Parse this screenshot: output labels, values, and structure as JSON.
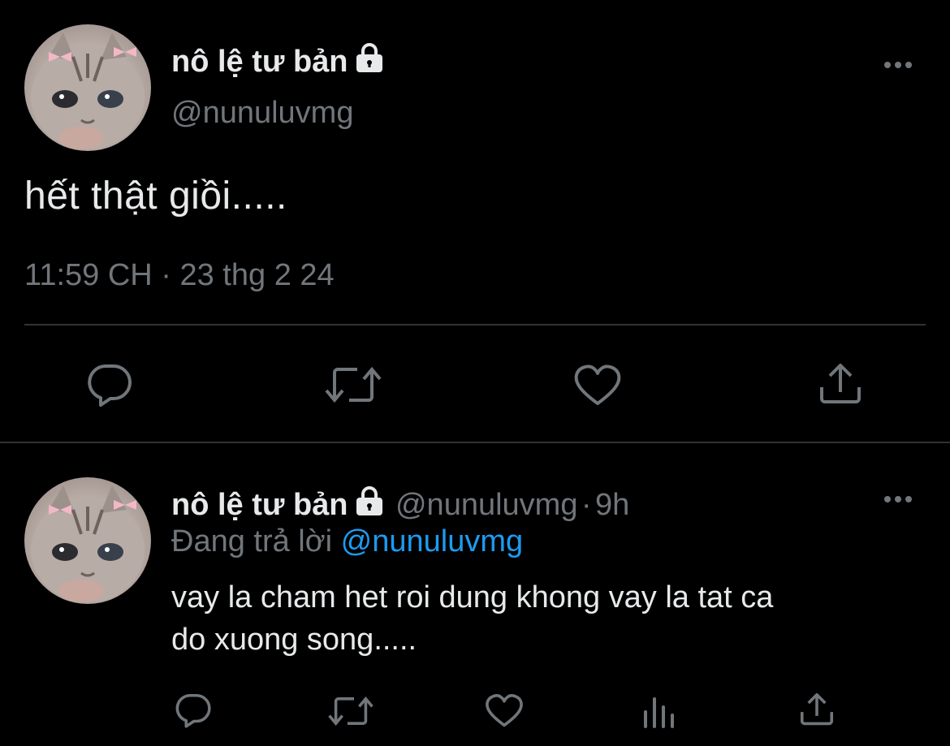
{
  "tweet": {
    "author_name": "nô lệ tư bản",
    "author_handle": "@nunuluvmg",
    "text": "hết thật giồi.....",
    "timestamp": "11:59 CH · 23 thg 2 24",
    "icons": [
      "reply-icon",
      "retweet-icon",
      "like-icon",
      "share-icon",
      "lock-icon",
      "more-icon"
    ]
  },
  "reply": {
    "author_name": "nô lệ tư bản",
    "author_handle": "@nunuluvmg",
    "separator": "·",
    "age": "9h",
    "replying_to_prefix": "Đang trả lời",
    "replying_to_handle": "@nunuluvmg",
    "text_line1": "vay la cham het roi dung khong vay la tat ca",
    "text_line2": "do xuong song.....",
    "icons": [
      "reply-icon",
      "retweet-icon",
      "like-icon",
      "views-icon",
      "share-icon",
      "lock-icon",
      "more-icon"
    ]
  },
  "colors": {
    "background": "#000000",
    "text": "#e7e9ea",
    "secondary": "#71767b",
    "link": "#1d9bf0",
    "divider": "#2f3336"
  }
}
